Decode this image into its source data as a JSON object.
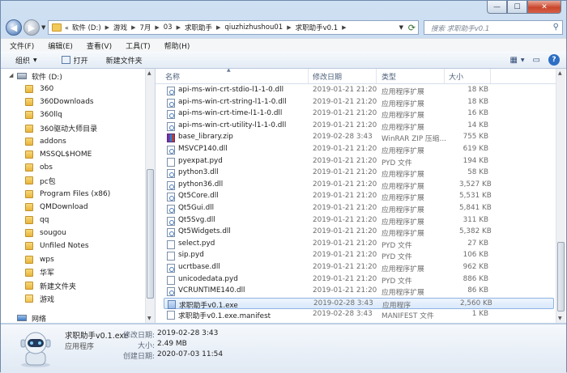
{
  "window": {
    "min": "—",
    "max": "☐",
    "close": "✕"
  },
  "nav": {
    "back_icon": "back-arrow-icon",
    "forward_icon": "forward-arrow-icon",
    "address": [
      "软件 (D:)",
      "游戏",
      "7月",
      "03",
      "求职助手",
      "qiuzhizhushou01",
      "求职助手v0.1"
    ],
    "search_placeholder": "搜索 求职助手v0.1"
  },
  "menu": [
    "文件(F)",
    "编辑(E)",
    "查看(V)",
    "工具(T)",
    "帮助(H)"
  ],
  "toolbar": {
    "organize": "组织",
    "open": "打开",
    "new_folder": "新建文件夹"
  },
  "sidebar": {
    "drive": "软件 (D:)",
    "items": [
      "360",
      "360Downloads",
      "360llq",
      "360驱动大师目录",
      "addons",
      "MSSQL$HOME",
      "obs",
      "pc包",
      "Program Files (x86)",
      "QMDownload",
      "qq",
      "sougou",
      "Unfiled Notes",
      "wps",
      "华军",
      "新建文件夹",
      "游戏"
    ],
    "network": "网络"
  },
  "columns": {
    "name": "名称",
    "date": "修改日期",
    "type": "类型",
    "size": "大小"
  },
  "files": [
    {
      "name": "api-ms-win-crt-stdio-l1-1-0.dll",
      "date": "2019-01-21 21:20",
      "type": "应用程序扩展",
      "size": "18 KB",
      "icon": "dll"
    },
    {
      "name": "api-ms-win-crt-string-l1-1-0.dll",
      "date": "2019-01-21 21:20",
      "type": "应用程序扩展",
      "size": "18 KB",
      "icon": "dll"
    },
    {
      "name": "api-ms-win-crt-time-l1-1-0.dll",
      "date": "2019-01-21 21:20",
      "type": "应用程序扩展",
      "size": "16 KB",
      "icon": "dll"
    },
    {
      "name": "api-ms-win-crt-utility-l1-1-0.dll",
      "date": "2019-01-21 21:20",
      "type": "应用程序扩展",
      "size": "14 KB",
      "icon": "dll"
    },
    {
      "name": "base_library.zip",
      "date": "2019-02-28 3:43",
      "type": "WinRAR ZIP 压缩...",
      "size": "755 KB",
      "icon": "zip"
    },
    {
      "name": "MSVCP140.dll",
      "date": "2019-01-21 21:20",
      "type": "应用程序扩展",
      "size": "619 KB",
      "icon": "dll"
    },
    {
      "name": "pyexpat.pyd",
      "date": "2019-01-21 21:20",
      "type": "PYD 文件",
      "size": "194 KB",
      "icon": "file"
    },
    {
      "name": "python3.dll",
      "date": "2019-01-21 21:20",
      "type": "应用程序扩展",
      "size": "58 KB",
      "icon": "dll"
    },
    {
      "name": "python36.dll",
      "date": "2019-01-21 21:20",
      "type": "应用程序扩展",
      "size": "3,527 KB",
      "icon": "dll"
    },
    {
      "name": "Qt5Core.dll",
      "date": "2019-01-21 21:20",
      "type": "应用程序扩展",
      "size": "5,531 KB",
      "icon": "dll"
    },
    {
      "name": "Qt5Gui.dll",
      "date": "2019-01-21 21:20",
      "type": "应用程序扩展",
      "size": "5,841 KB",
      "icon": "dll"
    },
    {
      "name": "Qt5Svg.dll",
      "date": "2019-01-21 21:20",
      "type": "应用程序扩展",
      "size": "311 KB",
      "icon": "dll"
    },
    {
      "name": "Qt5Widgets.dll",
      "date": "2019-01-21 21:20",
      "type": "应用程序扩展",
      "size": "5,382 KB",
      "icon": "dll"
    },
    {
      "name": "select.pyd",
      "date": "2019-01-21 21:20",
      "type": "PYD 文件",
      "size": "27 KB",
      "icon": "file"
    },
    {
      "name": "sip.pyd",
      "date": "2019-01-21 21:20",
      "type": "PYD 文件",
      "size": "106 KB",
      "icon": "file"
    },
    {
      "name": "ucrtbase.dll",
      "date": "2019-01-21 21:20",
      "type": "应用程序扩展",
      "size": "962 KB",
      "icon": "dll"
    },
    {
      "name": "unicodedata.pyd",
      "date": "2019-01-21 21:20",
      "type": "PYD 文件",
      "size": "886 KB",
      "icon": "file"
    },
    {
      "name": "VCRUNTIME140.dll",
      "date": "2019-01-21 21:20",
      "type": "应用程序扩展",
      "size": "86 KB",
      "icon": "dll"
    },
    {
      "name": "求职助手v0.1.exe",
      "date": "2019-02-28 3:43",
      "type": "应用程序",
      "size": "2,560 KB",
      "icon": "exe",
      "selected": true
    },
    {
      "name": "求职助手v0.1.exe.manifest",
      "date": "2019-02-28 3:43",
      "type": "MANIFEST 文件",
      "size": "1 KB",
      "icon": "file"
    }
  ],
  "details": {
    "name": "求职助手v0.1.exe",
    "type": "应用程序",
    "modified_label": "修改日期:",
    "modified": "2019-02-28 3:43",
    "size_label": "大小:",
    "size": "2.49 MB",
    "created_label": "创建日期:",
    "created": "2020-07-03 11:54"
  }
}
